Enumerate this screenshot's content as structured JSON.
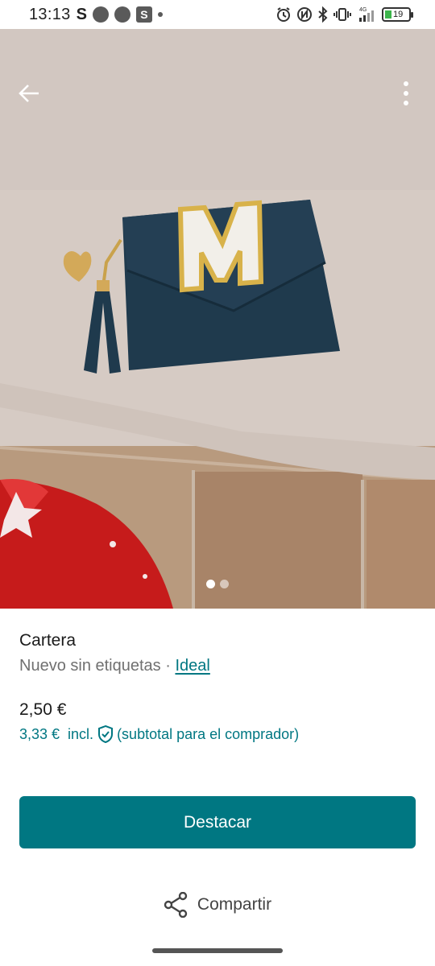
{
  "status_bar": {
    "time": "13:13",
    "s_glyph": "S",
    "box_glyph": "S",
    "network": "4G",
    "battery_level": "19",
    "icons": [
      "alarm-icon",
      "nfc-icon",
      "bluetooth-icon",
      "vibrate-icon",
      "signal-icon",
      "battery-icon"
    ]
  },
  "photo": {
    "description_icons": [
      "back-arrow-icon",
      "more-vertical-icon"
    ],
    "pagination": {
      "count": 2,
      "active": 1
    }
  },
  "item": {
    "title": "Cartera",
    "condition": "Nuevo sin etiquetas",
    "separator": " · ",
    "condition_link": "Ideal",
    "price": "2,50 €",
    "total_price": "3,33 €",
    "incl_label": "incl.",
    "buyer_note": "(subtotal para el comprador)"
  },
  "actions": {
    "primary": "Destacar",
    "share": "Compartir"
  },
  "colors": {
    "accent": "#007782",
    "text_primary": "#1a1a1a",
    "text_secondary": "#707070",
    "wallet": "#1f3a4d"
  }
}
